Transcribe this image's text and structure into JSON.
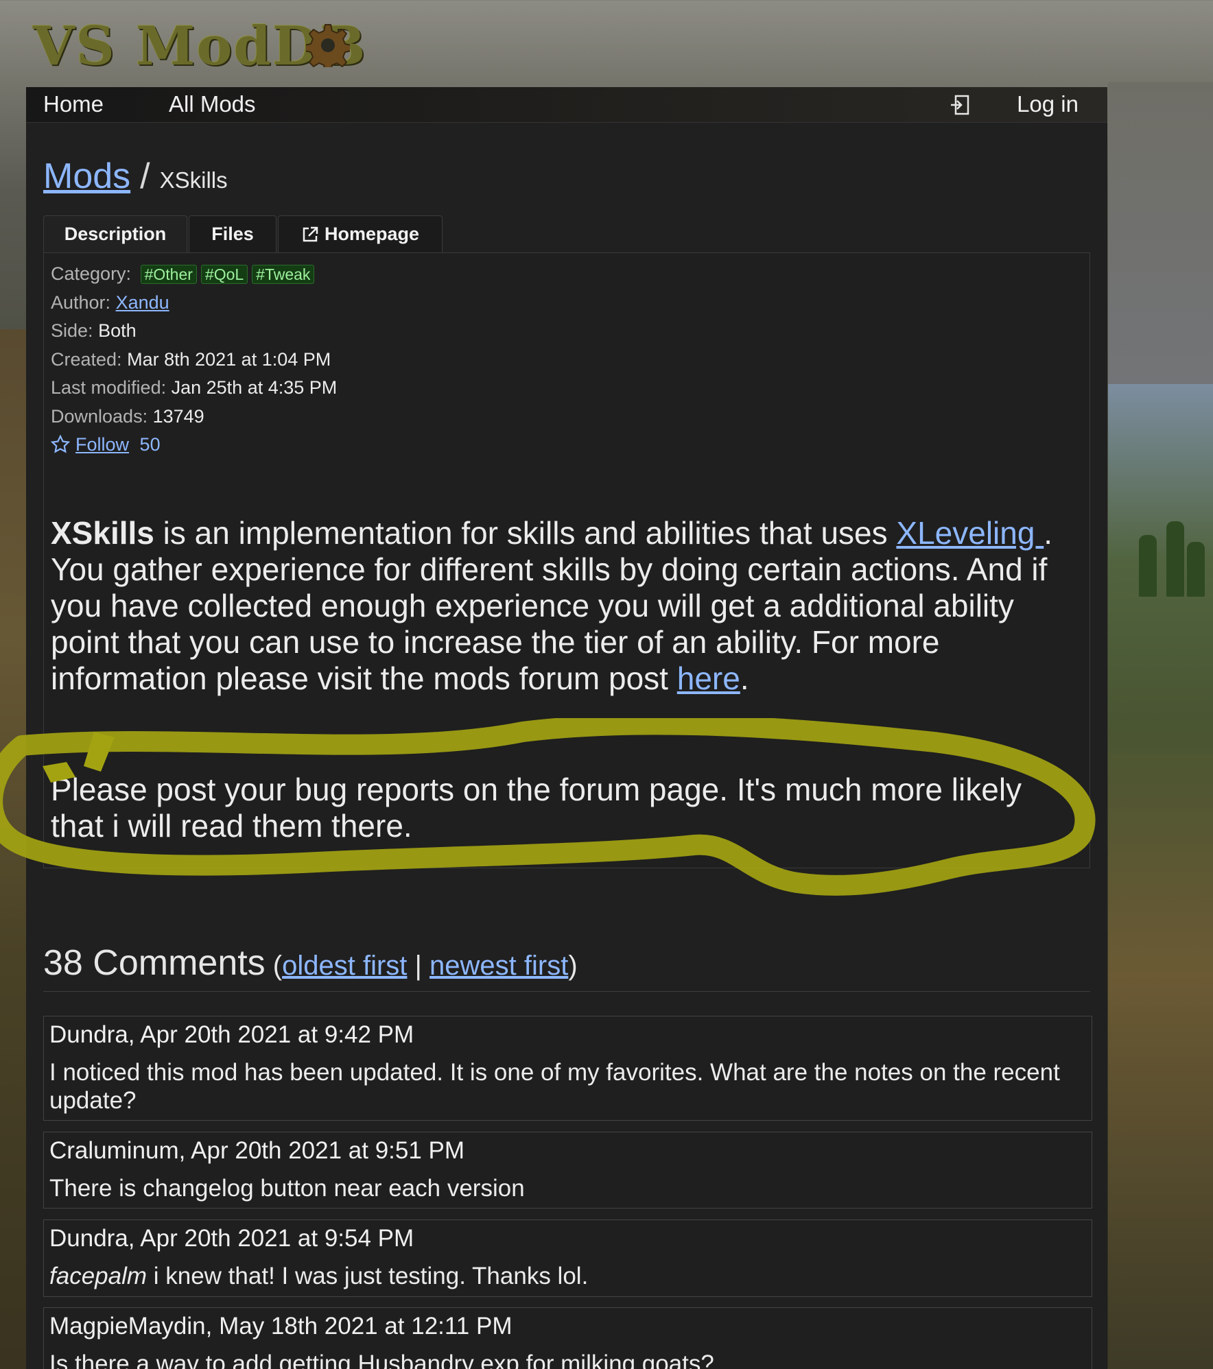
{
  "site": {
    "logo_text": "VS ModDB"
  },
  "nav": {
    "home": "Home",
    "all_mods": "All Mods",
    "login": "Log in"
  },
  "breadcrumb": {
    "root": "Mods",
    "separator": "/",
    "current": "XSkills"
  },
  "tabs": [
    {
      "label": "Description"
    },
    {
      "label": "Files"
    },
    {
      "label": "Homepage"
    }
  ],
  "meta": {
    "category_label": "Category:",
    "tags": [
      "#Other",
      "#QoL",
      "#Tweak"
    ],
    "author_label": "Author:",
    "author": "Xandu",
    "side_label": "Side:",
    "side": "Both",
    "created_label": "Created:",
    "created": "Mar 8th 2021 at 1:04 PM",
    "modified_label": "Last modified:",
    "modified": "Jan 25th at 4:35 PM",
    "downloads_label": "Downloads:",
    "downloads": "13749",
    "follow_label": "Follow",
    "follow_count": "50"
  },
  "description": {
    "p1_bold": "XSkills",
    "p1_a": " is an implementation for skills and abilities that uses ",
    "p1_link": "XLeveling ",
    "p1_b": ". You gather experience for different skills by doing certain actions. And if you have collected enough experience  you will get a additional ability point that you can use to increase the tier of an ability. For more information please visit the mods forum post ",
    "p1_link2": "here",
    "p1_end": ".",
    "p2": "Please post your bug reports on the forum page. It's much more likely that i will read them there."
  },
  "comments_header": {
    "count_text": "38 Comments",
    "open_paren": " (",
    "oldest": "oldest first",
    "divider": " | ",
    "newest": "newest first",
    "close_paren": ")"
  },
  "comments": [
    {
      "header": "Dundra, Apr 20th 2021 at 9:42 PM",
      "body": "I noticed this mod has been updated. It is one of my favorites. What are the notes on the recent update?"
    },
    {
      "header": "Craluminum, Apr 20th 2021 at 9:51 PM",
      "body": "There is changelog button near each version"
    },
    {
      "header": "Dundra, Apr 20th 2021 at 9:54 PM",
      "body_em": "facepalm",
      "body": " i knew that! I was just testing. Thanks lol."
    },
    {
      "header": "MagpieMaydin, May 18th 2021 at 12:11 PM",
      "body": "Is there a way to add getting Husbandry exp for milking goats?"
    }
  ],
  "colors": {
    "link": "#8db7ff",
    "highlight": "#a3a312",
    "tag_bg": "#143d14",
    "panel": "#202020"
  }
}
